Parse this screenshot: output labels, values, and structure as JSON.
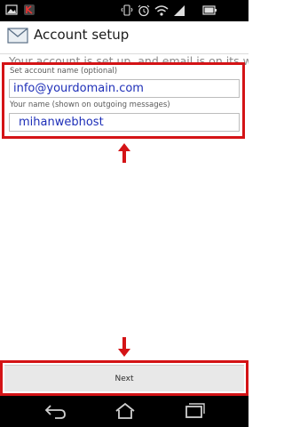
{
  "status_bar": {
    "icons": [
      "picture-icon",
      "app-notification-icon",
      "vibrate-icon",
      "alarm-icon",
      "wifi-icon",
      "signal-icon",
      "battery-icon"
    ]
  },
  "app_bar": {
    "title": "Account setup",
    "icon": "envelope-icon"
  },
  "intro": "Your account is set up, and email is on its way!",
  "form": {
    "account_name_label": "Set account name (optional)",
    "account_name_value": "info@yourdomain.com",
    "your_name_label": "Your name (shown on outgoing messages)",
    "your_name_value": "mihanwebhost"
  },
  "next_button": {
    "label": "Next"
  },
  "nav_bar": {
    "icons": [
      "back-icon",
      "home-icon",
      "recents-icon"
    ]
  },
  "colors": {
    "highlight": "#d41316",
    "input_text": "#1e2fb8",
    "status_bar_bg": "#000000"
  }
}
